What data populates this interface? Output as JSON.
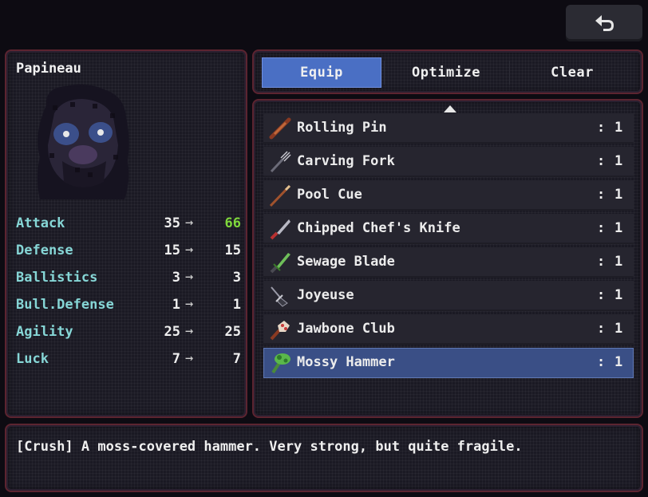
{
  "back_button": {
    "icon": "return-arrow-icon"
  },
  "character": {
    "name": "Papineau",
    "stats": [
      {
        "name": "Attack",
        "current": "35",
        "arrow": "→",
        "new": "66",
        "improved": true
      },
      {
        "name": "Defense",
        "current": "15",
        "arrow": "→",
        "new": "15",
        "improved": false
      },
      {
        "name": "Ballistics",
        "current": "3",
        "arrow": "→",
        "new": "3",
        "improved": false
      },
      {
        "name": "Bull.Defense",
        "current": "1",
        "arrow": "→",
        "new": "1",
        "improved": false
      },
      {
        "name": "Agility",
        "current": "25",
        "arrow": "→",
        "new": "25",
        "improved": false
      },
      {
        "name": "Luck",
        "current": "7",
        "arrow": "→",
        "new": "7",
        "improved": false
      }
    ]
  },
  "tabs": [
    {
      "label": "Equip",
      "active": true
    },
    {
      "label": "Optimize",
      "active": false
    },
    {
      "label": "Clear",
      "active": false
    }
  ],
  "items": [
    {
      "name": "Rolling Pin",
      "colon": ":",
      "qty": "1",
      "icon": "rolling-pin-icon"
    },
    {
      "name": "Carving Fork",
      "colon": ":",
      "qty": "1",
      "icon": "carving-fork-icon"
    },
    {
      "name": "Pool Cue",
      "colon": ":",
      "qty": "1",
      "icon": "pool-cue-icon"
    },
    {
      "name": "Chipped Chef's Knife",
      "colon": ":",
      "qty": "1",
      "icon": "chef-knife-icon"
    },
    {
      "name": "Sewage Blade",
      "colon": ":",
      "qty": "1",
      "icon": "sewage-blade-icon"
    },
    {
      "name": "Joyeuse",
      "colon": ":",
      "qty": "1",
      "icon": "joyeuse-icon"
    },
    {
      "name": "Jawbone Club",
      "colon": ":",
      "qty": "1",
      "icon": "jawbone-club-icon"
    },
    {
      "name": "Mossy Hammer",
      "colon": ":",
      "qty": "1",
      "icon": "mossy-hammer-icon",
      "selected": true
    }
  ],
  "description": {
    "text": "[Crush] A moss-covered hammer. Very strong, but quite fragile."
  },
  "colors": {
    "accent_blue": "#4a6fc4",
    "selected_row": "#3a4f86",
    "stat_label": "#86d6d6",
    "stat_up": "#7fd83c",
    "panel_border": "#5c2430"
  }
}
